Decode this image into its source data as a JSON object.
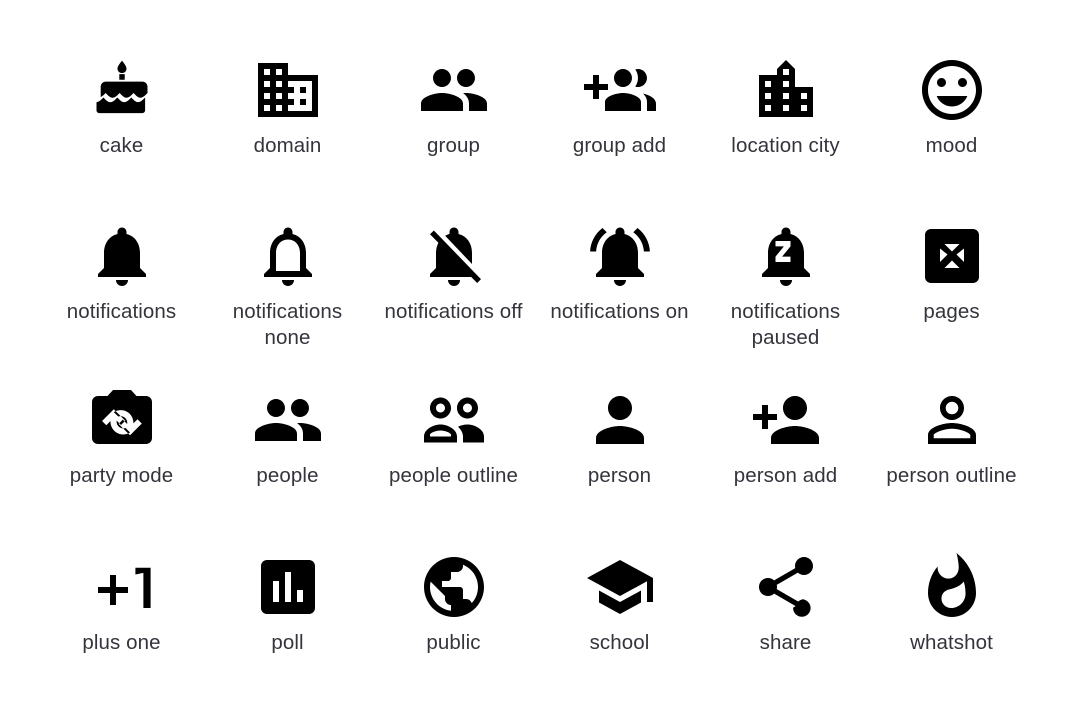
{
  "page": {
    "background_color": "#ffffff",
    "icon_color": "#000000",
    "label_color": "#34343c",
    "columns": 6,
    "rows": 4,
    "total_icons": 24
  },
  "icons": [
    {
      "name": "cake",
      "label": "cake",
      "row": 1,
      "col": 1
    },
    {
      "name": "domain",
      "label": "domain",
      "row": 1,
      "col": 2
    },
    {
      "name": "group",
      "label": "group",
      "row": 1,
      "col": 3
    },
    {
      "name": "group-add",
      "label": "group add",
      "row": 1,
      "col": 4
    },
    {
      "name": "location-city",
      "label": "location city",
      "row": 1,
      "col": 5
    },
    {
      "name": "mood",
      "label": "mood",
      "row": 1,
      "col": 6
    },
    {
      "name": "notifications",
      "label": "notifications",
      "row": 2,
      "col": 1
    },
    {
      "name": "notifications-none",
      "label": "notifications\nnone",
      "row": 2,
      "col": 2
    },
    {
      "name": "notifications-off",
      "label": "notifications off",
      "row": 2,
      "col": 3
    },
    {
      "name": "notifications-on",
      "label": "notifications on",
      "row": 2,
      "col": 4
    },
    {
      "name": "notifications-paused",
      "label": "notifications\npaused",
      "row": 2,
      "col": 5
    },
    {
      "name": "pages",
      "label": "pages",
      "row": 2,
      "col": 6
    },
    {
      "name": "party-mode",
      "label": "party mode",
      "row": 3,
      "col": 1
    },
    {
      "name": "people",
      "label": "people",
      "row": 3,
      "col": 2
    },
    {
      "name": "people-outline",
      "label": "people outline",
      "row": 3,
      "col": 3
    },
    {
      "name": "person",
      "label": "person",
      "row": 3,
      "col": 4
    },
    {
      "name": "person-add",
      "label": "person add",
      "row": 3,
      "col": 5
    },
    {
      "name": "person-outline",
      "label": "person outline",
      "row": 3,
      "col": 6
    },
    {
      "name": "plus-one",
      "label": "plus one",
      "row": 4,
      "col": 1
    },
    {
      "name": "poll",
      "label": "poll",
      "row": 4,
      "col": 2
    },
    {
      "name": "public",
      "label": "public",
      "row": 4,
      "col": 3
    },
    {
      "name": "school",
      "label": "school",
      "row": 4,
      "col": 4
    },
    {
      "name": "share",
      "label": "share",
      "row": 4,
      "col": 5
    },
    {
      "name": "whatshot",
      "label": "whatshot",
      "row": 4,
      "col": 6
    }
  ]
}
